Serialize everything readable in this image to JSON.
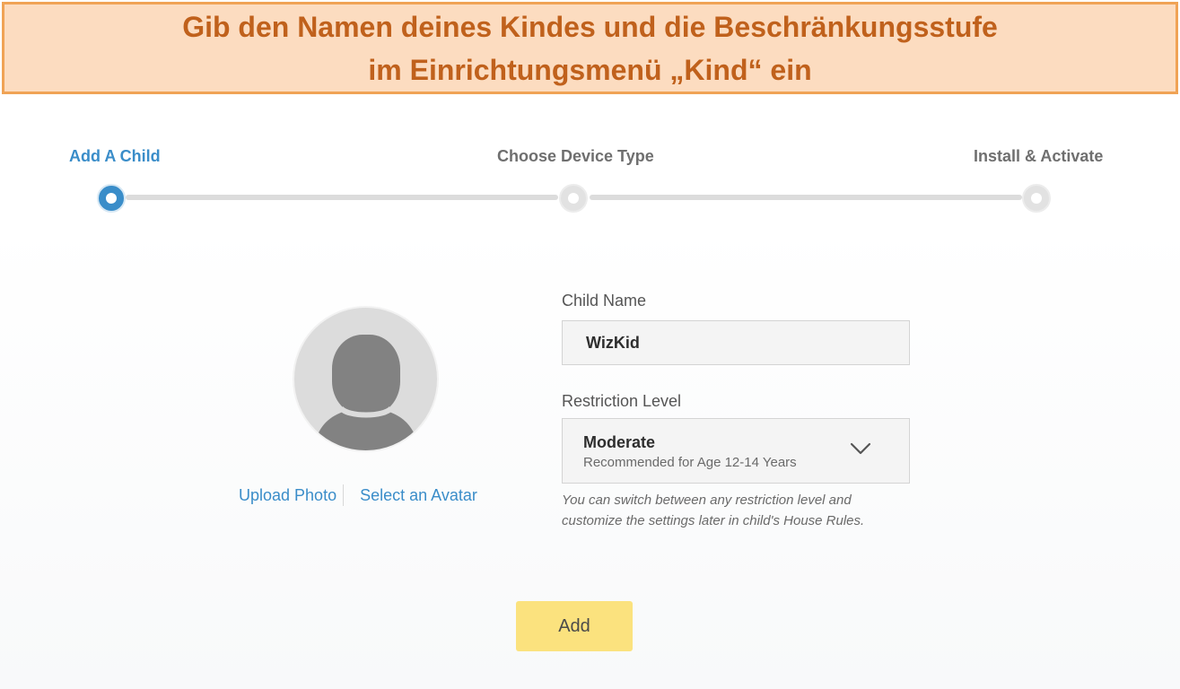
{
  "caption": {
    "line1": "Gib den Namen deines Kindes und die Beschränkungsstufe",
    "line2": "im Einrichtungsmenü „Kind“ ein"
  },
  "steps": [
    {
      "label": "Add A Child",
      "active": true
    },
    {
      "label": "Choose Device Type",
      "active": false
    },
    {
      "label": "Install & Activate",
      "active": false
    }
  ],
  "avatar": {
    "upload_label": "Upload Photo",
    "select_label": "Select an Avatar"
  },
  "form": {
    "child_name_label": "Child Name",
    "child_name_value": "WizKid",
    "restriction_label": "Restriction Level",
    "restriction_value": "Moderate",
    "restriction_subtitle": "Recommended for Age 12-14 Years",
    "hint_line1": "You can switch between any restriction level and",
    "hint_line2": "customize the settings later in child's House Rules."
  },
  "actions": {
    "add_label": "Add"
  },
  "colors": {
    "accent": "#3a8dc9",
    "button": "#fbe27e",
    "banner_bg": "#fcdcc0",
    "banner_border": "#f0a355",
    "banner_text": "#c0611c"
  }
}
